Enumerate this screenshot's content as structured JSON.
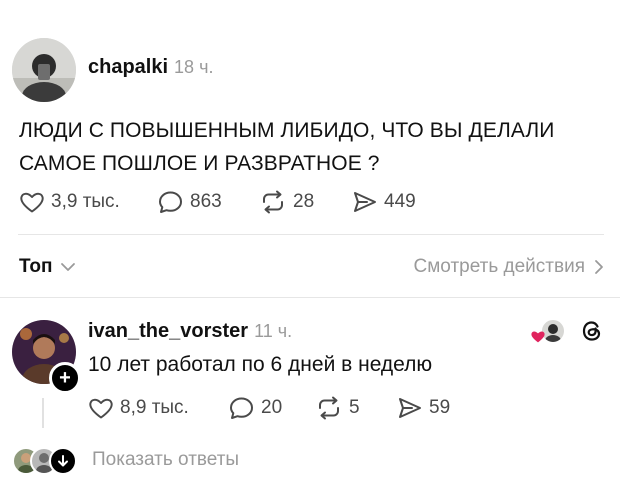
{
  "post": {
    "username": "chapalki",
    "time": "18 ч.",
    "text_line1": "ЛЮДИ С ПОВЫШЕННЫМ ЛИБИДО, ЧТО ВЫ ДЕЛАЛИ",
    "text_line2": "САМОЕ ПОШЛОЕ И РАЗВРАТНОЕ ?",
    "likes": "3,9 тыс.",
    "comments": "863",
    "reposts": "28",
    "shares": "449"
  },
  "sort": {
    "label": "Топ",
    "view_activity": "Смотреть действия"
  },
  "reply": {
    "username": "ivan_the_vorster",
    "time": "11 ч.",
    "text": "10 лет работал по 6 дней в неделю",
    "likes": "8,9 тыс.",
    "comments": "20",
    "reposts": "5",
    "shares": "59",
    "follow_symbol": "+"
  },
  "replies": {
    "show_label": "Показать ответы"
  },
  "colors": {
    "heart": "#e0245e",
    "icon_gray": "#4a4a4a",
    "muted": "#9a9a9a"
  },
  "icons": [
    "heart-icon",
    "comment-icon",
    "repost-icon",
    "share-icon",
    "chevron-down-icon",
    "chevron-right-icon",
    "threads-icon",
    "arrow-down-icon"
  ]
}
